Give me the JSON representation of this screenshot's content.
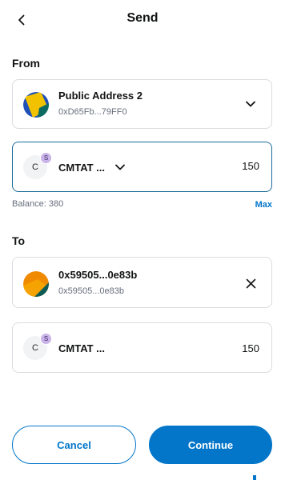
{
  "header": {
    "title": "Send",
    "back_icon": "chevron-left-icon"
  },
  "from": {
    "label": "From",
    "account": {
      "name": "Public Address 2",
      "address": "0xD65Fb...79FF0"
    },
    "asset": {
      "token_letter": "C",
      "badge_letter": "S",
      "symbol": "CMTAT ...",
      "amount": "150",
      "balance": "Balance: 380",
      "max_label": "Max"
    }
  },
  "to": {
    "label": "To",
    "account": {
      "name": "0x59505...0e83b",
      "address": "0x59505...0e83b"
    },
    "asset": {
      "token_letter": "C",
      "badge_letter": "S",
      "symbol": "CMTAT ...",
      "amount": "150"
    }
  },
  "footer": {
    "cancel_label": "Cancel",
    "continue_label": "Continue"
  },
  "colors": {
    "primary": "#0376c9",
    "border": "#d9dce0",
    "badge": "#c9b3e8"
  }
}
